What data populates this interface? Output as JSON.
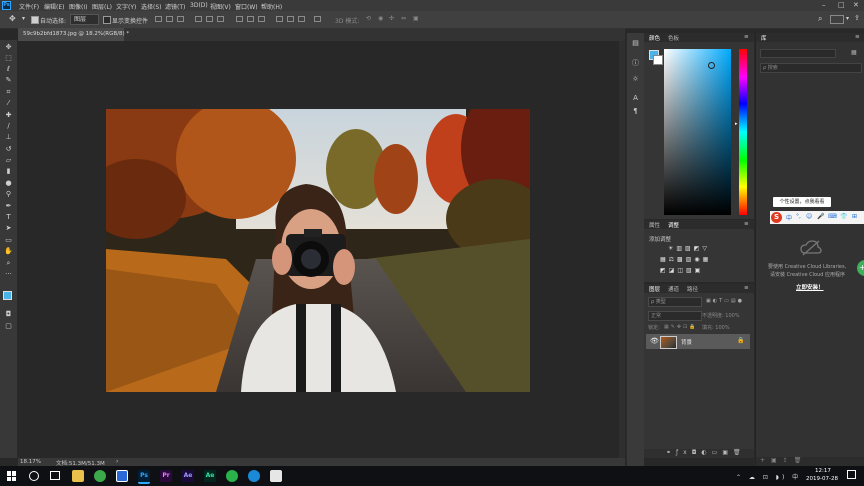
{
  "menubar": {
    "logo": "Ps",
    "items": [
      "文件(F)",
      "编辑(E)",
      "图像(I)",
      "图层(L)",
      "文字(Y)",
      "选择(S)",
      "滤镜(T)",
      "3D(D)",
      "视图(V)",
      "窗口(W)",
      "帮助(H)"
    ]
  },
  "options": {
    "auto_select_label": "自动选择:",
    "auto_select_value": "图层",
    "show_transform_label": "显示变换控件",
    "mode3d_label": "3D 模式:"
  },
  "document": {
    "tab_title": "59c9b2bfd1873.jpg @ 18.2%(RGB/8) *",
    "zoom_status": "18.17%",
    "doc_size": "文档:51.3M/51.3M"
  },
  "color_panel": {
    "tabs": [
      "颜色",
      "色板"
    ]
  },
  "adjust_panel": {
    "tabs": [
      "属性",
      "调整"
    ],
    "add_label": "添加调整"
  },
  "layers_panel": {
    "tabs": [
      "图层",
      "通道",
      "路径"
    ],
    "search_placeholder": "ρ 类型",
    "blend_mode": "正常",
    "opacity_label": "不透明度: 100%",
    "lock_label": "锁定:",
    "fill_label": "填充: 100%",
    "layer_name": "背景"
  },
  "library_panel": {
    "tab": "库",
    "search_placeholder": "搜索",
    "tooltip": "个性设置，点我看看",
    "message_line1": "要使用 Creative Cloud Libraries,",
    "message_line2": "请安装 Creative Cloud 应用程序",
    "install_link": "立即安装！"
  },
  "ime_bar": {
    "items": [
      "中",
      "°,",
      "☺",
      "🎤",
      "⌨",
      "👕",
      "⊞"
    ]
  },
  "taskbar": {
    "time": "12:17",
    "date": "2019-07-28",
    "apps": [
      "Ps",
      "Pr",
      "Ae",
      "Ae"
    ]
  },
  "colors": {
    "accent": "#31a8ff",
    "foreground_swatch": "#4ab4e8",
    "premiere": "#9999ff",
    "after_effects": "#9999ff",
    "sogou": "#e03a1e"
  }
}
